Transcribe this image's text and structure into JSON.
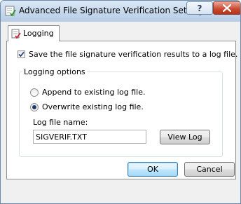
{
  "window": {
    "title": "Advanced File Signature Verification Settings",
    "help_label": "?"
  },
  "tabs": [
    {
      "label": "Logging",
      "icon": "logging-icon"
    }
  ],
  "logging": {
    "save_to_log_label": "Save the file signature verification results to a log file.",
    "save_to_log_checked": true,
    "options_group_title": "Logging options",
    "append_label": "Append to existing log file.",
    "append_selected": false,
    "overwrite_label": "Overwrite existing log file.",
    "overwrite_selected": true,
    "file_name_label": "Log file name:",
    "file_name_value": "SIGVERIF.TXT",
    "view_log_label": "View Log"
  },
  "footer": {
    "ok_label": "OK",
    "cancel_label": "Cancel"
  }
}
